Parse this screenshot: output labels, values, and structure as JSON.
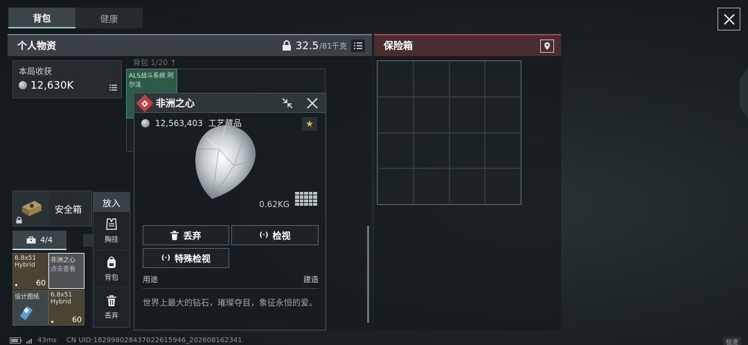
{
  "tabs": [
    {
      "label": "背包",
      "active": true
    },
    {
      "label": "健康",
      "active": false
    }
  ],
  "personal": {
    "title": "个人物资",
    "weight_current": "32.5",
    "weight_max": "/81千克"
  },
  "vault": {
    "title": "保险箱"
  },
  "harvest": {
    "label": "本局收获",
    "amount": "12,630K"
  },
  "bag_header": "背包  1/20  ↑",
  "bag_item_text": "ALS战斗系统 阿尔法",
  "safe": {
    "label": "安全箱"
  },
  "putin": {
    "header": "放入",
    "options": [
      {
        "label": "胸挂",
        "icon": "vest-icon"
      },
      {
        "label": "背包",
        "icon": "backpack-icon"
      },
      {
        "label": "丢弃",
        "icon": "trash-icon"
      }
    ]
  },
  "box_tab": {
    "label": "4/4"
  },
  "tiles": [
    {
      "name": "6.8x51 Hybrid",
      "count": "60"
    },
    {
      "name": "非洲之心",
      "sub": "点击查看"
    },
    {
      "name": "设计图纸"
    },
    {
      "name": "6.8x51 Hybrid",
      "count": "60"
    }
  ],
  "detail": {
    "name": "非洲之心",
    "price": "12,563,403",
    "category": "工艺藏品",
    "weight": "0.62KG",
    "actions": {
      "discard": "丢弃",
      "inspect": "检视",
      "special_inspect": "特殊检视"
    },
    "use_label": "用途",
    "build_label": "建造",
    "description": "世界上最大的钻石，璀璨夺目，象征永恒的爱。"
  },
  "status": {
    "ping": "43ms",
    "uid": "CN UID:182998028437022615946_202608162341",
    "speed": "极速"
  },
  "colors": {
    "accent_green": "#8fd3bf",
    "vault_red": "#b0404c",
    "rarity_red": "#c63c45",
    "star_gold": "#e8b84b"
  }
}
